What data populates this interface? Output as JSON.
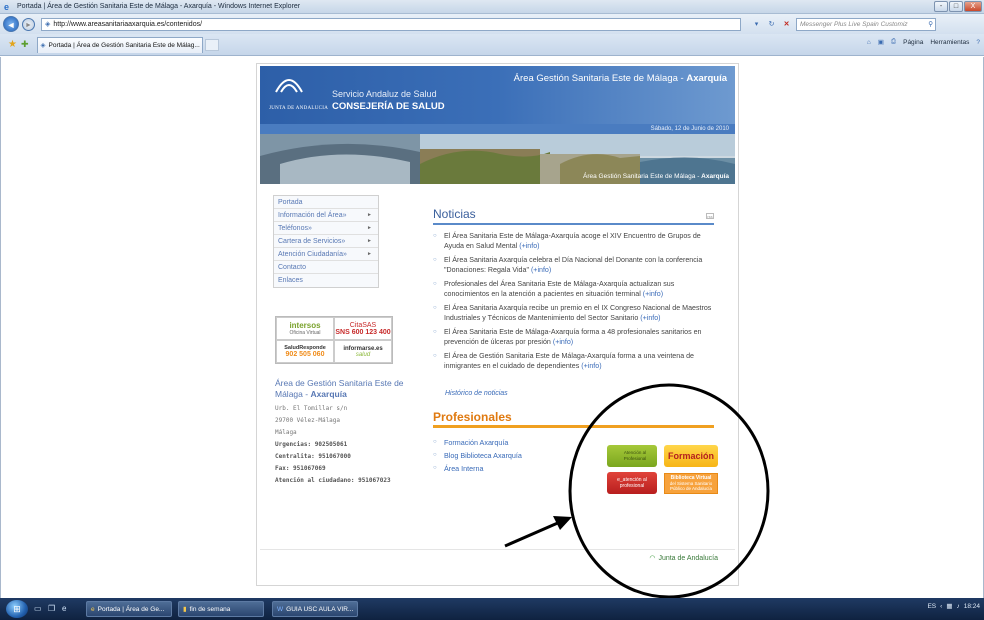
{
  "window": {
    "title": "Portada | Área de Gestión Sanitaria Este de Málaga - Axarquía - Windows Internet Explorer",
    "controls": [
      "-",
      "□",
      "X"
    ]
  },
  "addressbar": {
    "url": "http://www.areasanitariaaxarquia.es/contenidos/",
    "search_placeholder": "Messenger Plus Live Spain Customiz"
  },
  "tabs": {
    "active_label": "Portada | Área de Gestión Sanitaria Este de Málag...",
    "commands": [
      "Página",
      "Herramientas"
    ]
  },
  "banner": {
    "junta": "JUNTA DE ANDALUCIA",
    "sas": "Servicio Andaluz de Salud",
    "consejeria": "CONSEJERÍA DE SALUD",
    "area_prefix": "Área Gestión Sanitaria Este de Málaga - ",
    "area_bold": "Axarquía",
    "date": "Sábado, 12 de Junio de 2010",
    "hero_caption_prefix": "Área Gestión Sanitaria Este de Málaga - ",
    "hero_caption_bold": "Axarquía"
  },
  "menu": {
    "items": [
      {
        "label": "Portada",
        "arrow": ""
      },
      {
        "label": "Información del Área»",
        "arrow": "►"
      },
      {
        "label": "Teléfonos»",
        "arrow": "►"
      },
      {
        "label": "Cartera de Servicios»",
        "arrow": "►"
      },
      {
        "label": "Atención Ciudadanía»",
        "arrow": "►"
      },
      {
        "label": "Contacto",
        "arrow": ""
      },
      {
        "label": "Enlaces",
        "arrow": ""
      }
    ]
  },
  "partners": {
    "intersos_name": "intersos",
    "intersos_sub": "Oficina Virtual",
    "citasas_name": "CitaSAS",
    "citasas_sub": "SNS 600 123 400",
    "salud_name": "SaludResponde",
    "salud_sub": "902 505 060",
    "informarse_name": "informarse.es",
    "informarse_sub": "salud"
  },
  "address": {
    "title_prefix": "Área de Gestión Sanitaria Este de Málaga - ",
    "title_bold": "Axarquía",
    "lines": [
      "Urb. El Tomillar s/n",
      "29700 Vélez-Málaga",
      "Málaga"
    ],
    "bold_lines": [
      "Urgencias: 902505061",
      "Centralita: 951067000",
      "Fax: 951067069",
      "Atención al ciudadano: 951067023"
    ]
  },
  "noticias": {
    "title": "Noticias",
    "rss": "rss",
    "items": [
      {
        "text": "El Área Sanitaria Este de Málaga-Axarquía acoge el XIV Encuentro de Grupos de Ayuda en Salud Mental ",
        "link": "(+info)"
      },
      {
        "text": "El Área Sanitaria Axarquía celebra el Día Nacional del Donante con la conferencia \"Donaciones: Regala Vida\" ",
        "link": "(+info)"
      },
      {
        "text": "Profesionales del Área Sanitaria Este de Málaga-Axarquía actualizan sus conocimientos en la atención a pacientes en situación terminal ",
        "link": "(+info)"
      },
      {
        "text": "El Área Sanitaria Axarquía recibe un premio en el IX Congreso Nacional de Maestros Industriales y Técnicos de Mantenimiento del Sector Sanitario ",
        "link": "(+info)"
      },
      {
        "text": "El Área Sanitaria Este de Málaga-Axarquía forma a 48 profesionales sanitarios en prevención de úlceras por presión ",
        "link": "(+info)"
      },
      {
        "text": "El Área de Gestión Sanitaria Este de Málaga-Axarquía forma a una veintena de inmigrantes en el cuidado de dependientes ",
        "link": "(+info)"
      }
    ],
    "historico": "Histórico de noticias"
  },
  "profesionales": {
    "title": "Profesionales",
    "items": [
      "Formación Axarquía",
      "Blog Biblioteca Axarquía",
      "Área Interna"
    ],
    "btn_atencion": "Atención al Profesional",
    "btn_formacion": "Formación",
    "btn_eatencion": "e_atención al profesional",
    "btn_biblio_title": "Biblioteca Virtual",
    "btn_biblio_sub": "del Sistema Sanitario Público de Andalucía"
  },
  "footer": {
    "junta": "Junta de Andalucía"
  },
  "taskbar": {
    "tasks": [
      "Portada | Área de Ge...",
      "fin de semana",
      "GUIA USC AULA VIR..."
    ],
    "tray_time": "18:24",
    "tray_lang": "ES"
  }
}
